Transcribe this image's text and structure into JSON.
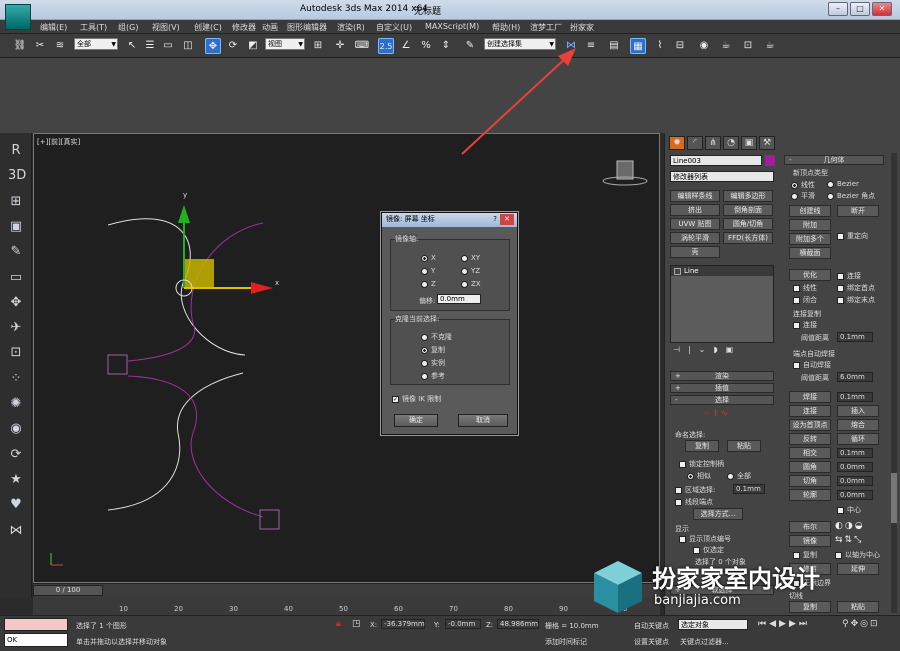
{
  "app": {
    "title": "Autodesk 3ds Max  2014 x64",
    "doc": "无标题",
    "win_buttons": [
      "–",
      "□",
      "✕"
    ]
  },
  "menu": [
    "编辑(E)",
    "工具(T)",
    "组(G)",
    "视图(V)",
    "创建(C)",
    "修改器",
    "动画",
    "图形编辑器",
    "渲染(R)",
    "自定义(U)",
    "MAXScript(M)",
    "帮助(H)",
    "渲梦工厂",
    "扮家家"
  ],
  "toolbar": {
    "filter": "全部",
    "ref_coord": "视图",
    "snap_label": "2.5",
    "selection_set": "创建选择集"
  },
  "viewport": {
    "label": "[+][前][真实]",
    "axis_x": "x",
    "axis_y": "y"
  },
  "left_tools": [
    "R",
    "3D",
    "⊞",
    "▣",
    "✎",
    "▭",
    "✥",
    "✈",
    "⊡",
    "⁘",
    "✺",
    "◉",
    "⟳",
    "★",
    "♥",
    "⋈"
  ],
  "dialog": {
    "title": "镜像: 屏幕 坐标",
    "mirror_axis_label": "镜像轴:",
    "axes": [
      "X",
      "Y",
      "Z",
      "XY",
      "YZ",
      "ZX"
    ],
    "offset_label": "偏移:",
    "offset_value": "0.0mm",
    "clone_label": "克隆当前选择:",
    "clone_options": [
      "不克隆",
      "复制",
      "实例",
      "参考"
    ],
    "ik_label": "镜像 IK 限制",
    "ok": "确定",
    "cancel": "取消"
  },
  "cmdpanel": {
    "object_name": "Line003",
    "modifier_list": "修改器列表",
    "mod_buttons": [
      "编辑样条线",
      "编辑多边形",
      "挤出",
      "倒角剖面",
      "UVW 贴图",
      "圆角/切角",
      "涡轮平滑",
      "FFD(长方体)",
      "壳"
    ],
    "stack_item": "Line",
    "roll_render": "渲染",
    "roll_interp": "插值",
    "roll_select": "选择",
    "named_sel_label": "命名选择:",
    "copy": "复制",
    "paste": "粘贴",
    "lock_handles": "锁定控制柄",
    "similar": "相似",
    "all": "全部",
    "area_sel": "区域选择:",
    "area_val": "0.1mm",
    "seg_end": "线段端点",
    "select_by": "选择方式...",
    "display_label": "显示",
    "show_vertex_num": "显示顶点编号",
    "only_selected": "仅选定",
    "selected_count": "选择了 0 个对象",
    "soft_sel": "软选择",
    "geometry": "几何体",
    "new_vertex_type": "新顶点类型",
    "vt": [
      "线性",
      "Bezier",
      "平滑",
      "Bezier 角点"
    ],
    "create_line": "创建线",
    "break": "断开",
    "attach": "附加",
    "attach_multi": "附加多个",
    "reorient": "重定向",
    "cross_section": "横截面",
    "refine": "优化",
    "connect": "连接",
    "linear": "线性",
    "bind_first": "绑定首点",
    "closed": "闭合",
    "bind_last": "绑定末点",
    "connect_copy": "连接复制",
    "connect2": "连接",
    "threshold": "阈值距离",
    "thr_val": "0.1mm",
    "end_auto_weld": "端点自动焊接",
    "auto_weld": "自动焊接",
    "thr2": "阈值距离",
    "thr2_val": "6.0mm",
    "weld": "焊接",
    "weld_val": "0.1mm",
    "connect3": "连接",
    "insert": "插入",
    "set_first": "设为首顶点",
    "fuse": "熔合",
    "reverse": "反转",
    "cycle": "循环",
    "intersect": "相交",
    "int_val": "0.1mm",
    "fillet": "圆角",
    "fillet_val": "0.0mm",
    "chamfer": "切角",
    "chamfer_val": "0.0mm",
    "outline": "轮廓",
    "outline_val": "0.0mm",
    "center": "中心",
    "boolean": "布尔",
    "mirror": "镜像",
    "copy2": "复制",
    "about_pivot": "以轴为中心",
    "trim": "修剪",
    "extend": "延伸",
    "infinite": "无限边界",
    "tangent": "切线",
    "copy3": "复制",
    "paste2": "粘贴"
  },
  "timeline": {
    "range": "0 / 100",
    "ticks": [
      "10",
      "20",
      "30",
      "40",
      "50",
      "60",
      "70",
      "80",
      "90",
      "100"
    ]
  },
  "status": {
    "listener": "OK",
    "selected": "选择了 1 个图形",
    "prompt": "单击并拖动以选择并移动对象",
    "x_label": "X:",
    "x": "-36.379mm",
    "y_label": "Y:",
    "y": "-0.0mm",
    "z_label": "Z:",
    "z": "48.986mm",
    "grid": "栅格 = 10.0mm",
    "add_time_tag": "添加时间标记",
    "auto_key": "自动关键点",
    "sel_object": "选定对象",
    "set_key": "设置关键点",
    "key_filter": "关键点过滤器..."
  },
  "watermark": {
    "cn": "扮家家室内设计",
    "url": "banjiajia.com"
  },
  "colors": {
    "accent": "#2f6fc9",
    "arrow": "#e8413a",
    "curve_white": "#e0e0e0",
    "curve_magenta": "#a0309a",
    "gizmo_x": "#e02020",
    "gizmo_y": "#20b020",
    "gizmo_plane": "#d4c000"
  }
}
